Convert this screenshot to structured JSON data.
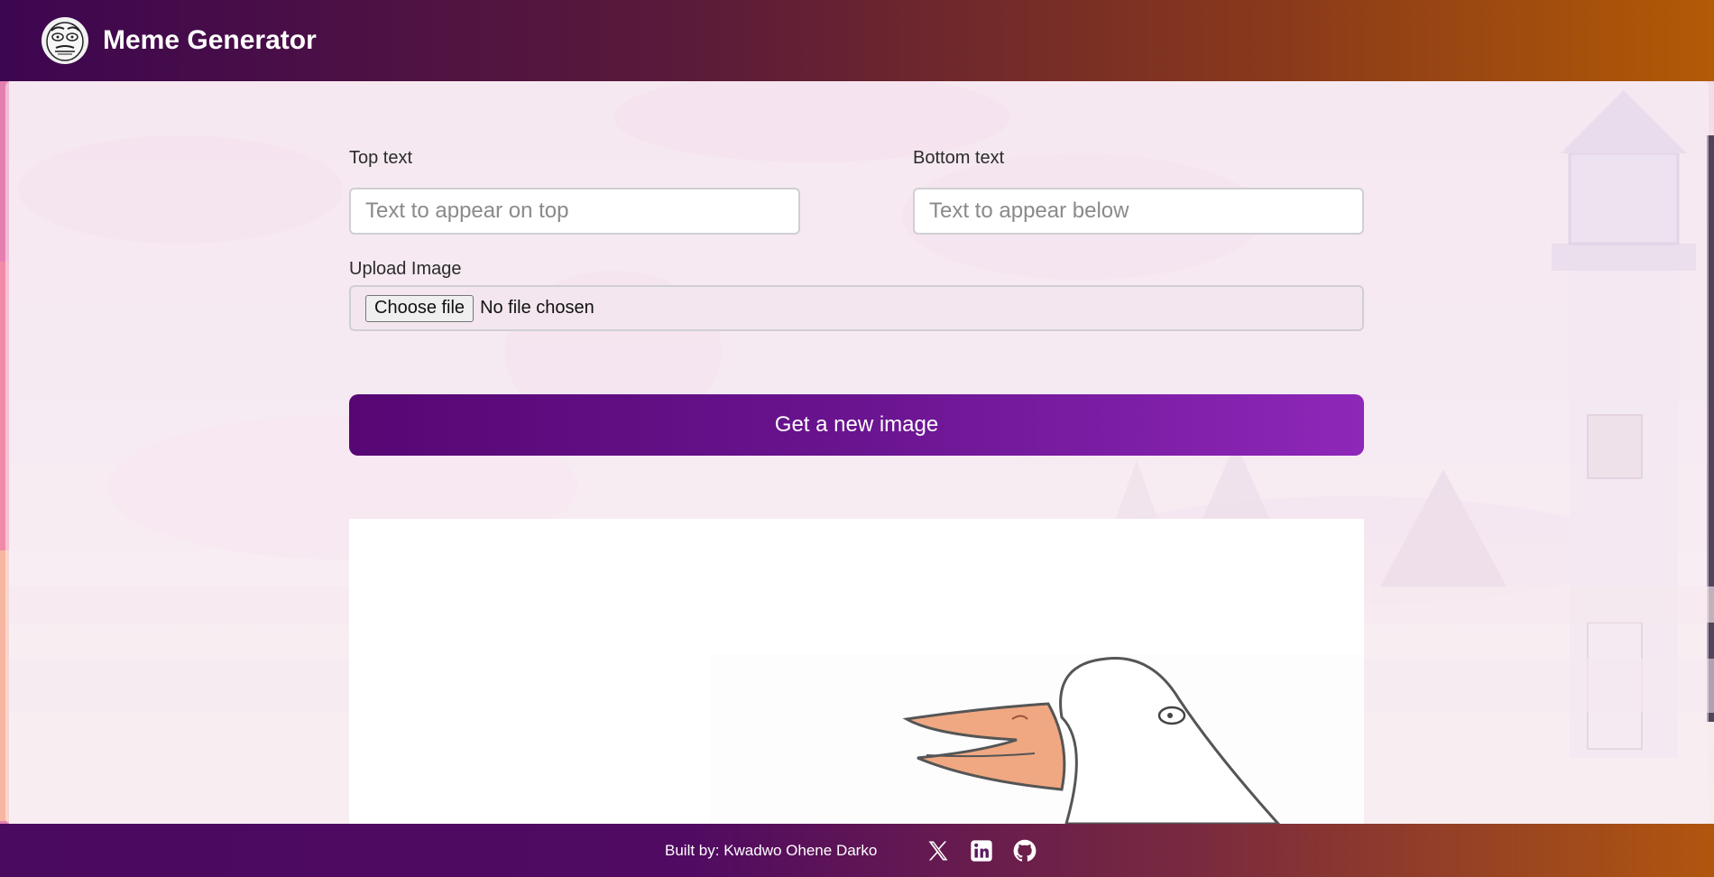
{
  "header": {
    "title": "Meme Generator",
    "logo_icon": "me-gusta-face-icon"
  },
  "form": {
    "top_text_label": "Top text",
    "top_text_placeholder": "Text to appear on top",
    "top_text_value": "",
    "bottom_text_label": "Bottom text",
    "bottom_text_placeholder": "Text to appear below",
    "bottom_text_value": "",
    "upload_label": "Upload Image",
    "file_button_label": "Choose file",
    "file_status": "No file chosen",
    "get_image_button_label": "Get a new image"
  },
  "meme": {
    "image_subject": "goose-drawing"
  },
  "footer": {
    "credit": "Built by: Kwadwo Ohene Darko",
    "social_icons": [
      "x-twitter-icon",
      "linkedin-icon",
      "github-icon"
    ]
  },
  "colors": {
    "accent_start": "#560773",
    "accent_end": "#8e27b9",
    "header_gradient_start": "#3d0650",
    "header_gradient_end": "#b25a06"
  }
}
